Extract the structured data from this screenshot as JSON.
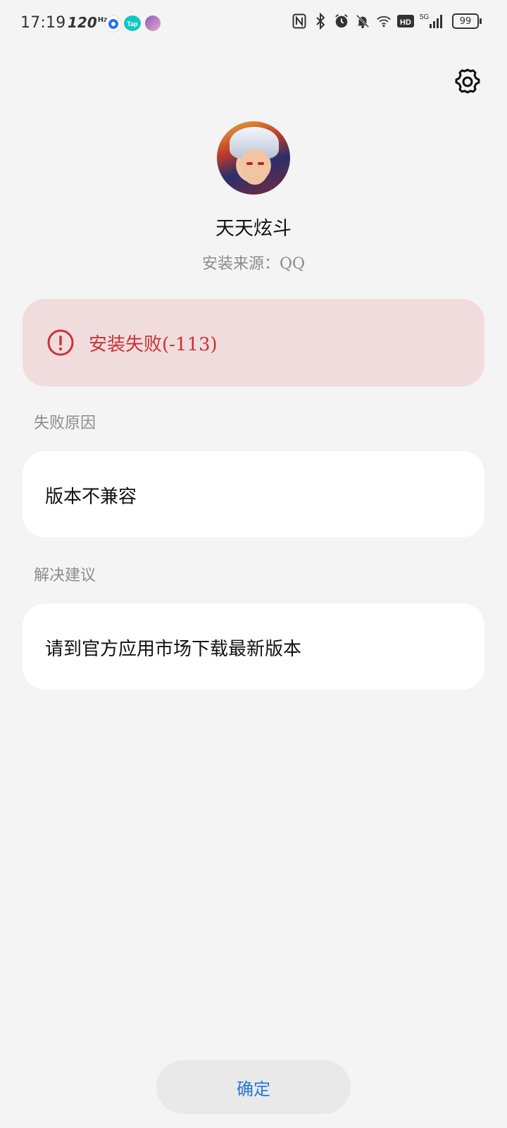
{
  "status_bar": {
    "time": "17:19",
    "refresh_rate": "120",
    "refresh_unit": "Hz",
    "tap_label": "Tap",
    "network": "5G",
    "hd_label": "HD",
    "battery": "99",
    "icons": [
      "nfc-icon",
      "bluetooth-icon",
      "alarm-icon",
      "mute-bell-icon",
      "wifi-icon",
      "hd-icon",
      "signal-icon",
      "battery-icon"
    ]
  },
  "header": {
    "settings_icon": "gear-icon"
  },
  "app": {
    "name": "天天炫斗",
    "source": "安装来源：QQ"
  },
  "error": {
    "icon": "error-icon",
    "message": "安装失败(-113)",
    "color": "#c8323a",
    "background": "#f0dcdc"
  },
  "reason": {
    "label": "失败原因",
    "text": "版本不兼容"
  },
  "suggestion": {
    "label": "解决建议",
    "text": "请到官方应用市场下载最新版本"
  },
  "actions": {
    "confirm_label": "确定",
    "accent": "#2a78d2"
  }
}
